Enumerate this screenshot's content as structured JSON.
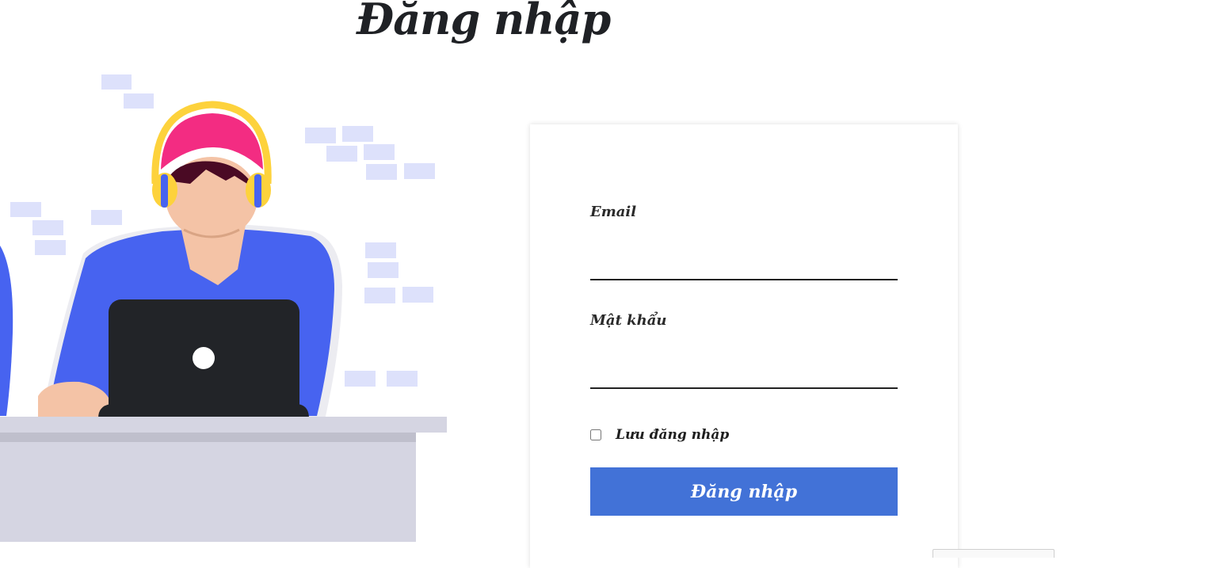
{
  "page": {
    "title": "Đăng nhập"
  },
  "login_form": {
    "email_label": "Email",
    "email_value": "",
    "password_label": "Mật khẩu",
    "password_value": "",
    "remember_label": "Lưu đăng nhập",
    "remember_checked": false,
    "submit_label": "Đăng nhập"
  },
  "colors": {
    "accent": "#4272d7",
    "text": "#1f2125",
    "shirt": "#4763f0",
    "cap": "#f32c82",
    "headphones": "#fdd23c",
    "laptop": "#222428",
    "bricks": "#dde1fb",
    "desk": "#d5d5e2"
  },
  "icons": {
    "illustration": "person-with-laptop-illustration"
  }
}
